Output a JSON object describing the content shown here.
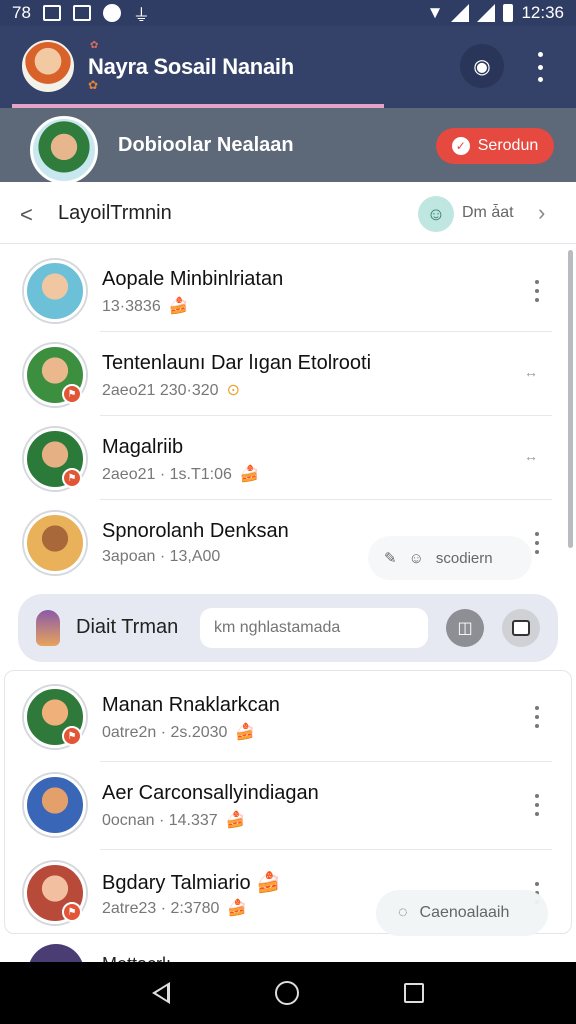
{
  "statusbar": {
    "left_text": "78",
    "time": "12:36"
  },
  "appbar": {
    "title": "Nayra Sosail Nanaih",
    "progress_pct": 65
  },
  "group": {
    "name": "Dobioolar Nealaan",
    "action_label": "Serodun"
  },
  "toolbar": {
    "title": "LayoilTrmnin",
    "dm_label": "Dm ǡat"
  },
  "conversations_top": [
    {
      "name": "Aopale Minbinlriatan",
      "meta": "13·3836",
      "emoji": "🍰",
      "action": "more",
      "badge": false,
      "avatar_colors": [
        "#f0c7a0",
        "#6cc0d8"
      ]
    },
    {
      "name": "Tentenlaunı Dar lıgan Etolrooti",
      "meta": "2aeo21  230·320",
      "emoji": "⊙",
      "action": "arrow",
      "badge": true,
      "avatar_colors": [
        "#eab88c",
        "#3b8f3f"
      ]
    },
    {
      "name": "Magalriib",
      "meta": "2aeo21 · 1s.T1:06",
      "emoji": "🍰",
      "action": "arrow",
      "badge": true,
      "avatar_colors": [
        "#e4b084",
        "#2c7a3a"
      ]
    },
    {
      "name": "Spnorolanh Denksan",
      "meta": "3apoan · 13,A00",
      "emoji": "",
      "action": "more",
      "badge": false,
      "avatar_colors": [
        "#a8683a",
        "#e8b15a"
      ]
    }
  ],
  "float_actions_1": {
    "label": "scodiern"
  },
  "inputbar": {
    "label": "Diait Trman",
    "placeholder": "km nghlastamada"
  },
  "conversations_bottom": [
    {
      "name": "Manan Rnaklarkcan",
      "meta": "0atre2n · 2s.2030",
      "emoji": "🍰",
      "badge": true,
      "avatar_colors": [
        "#f0b07a",
        "#2f7a3a"
      ]
    },
    {
      "name": "Aer Carconsallyindiagan",
      "meta": "0ocnan · 14.337",
      "emoji": "🍰",
      "badge": false,
      "avatar_colors": [
        "#e4a06a",
        "#3a66b8"
      ]
    },
    {
      "name": "Bgdary Talmiario 🍰",
      "meta": "2atre23 · 2:3780",
      "emoji": "🍰",
      "badge": true,
      "avatar_colors": [
        "#f2c0a0",
        "#b84a3a"
      ]
    }
  ],
  "float_actions_2": {
    "label": "Caenoalaaih"
  },
  "partial_row": {
    "name": "Mettacrlı"
  }
}
